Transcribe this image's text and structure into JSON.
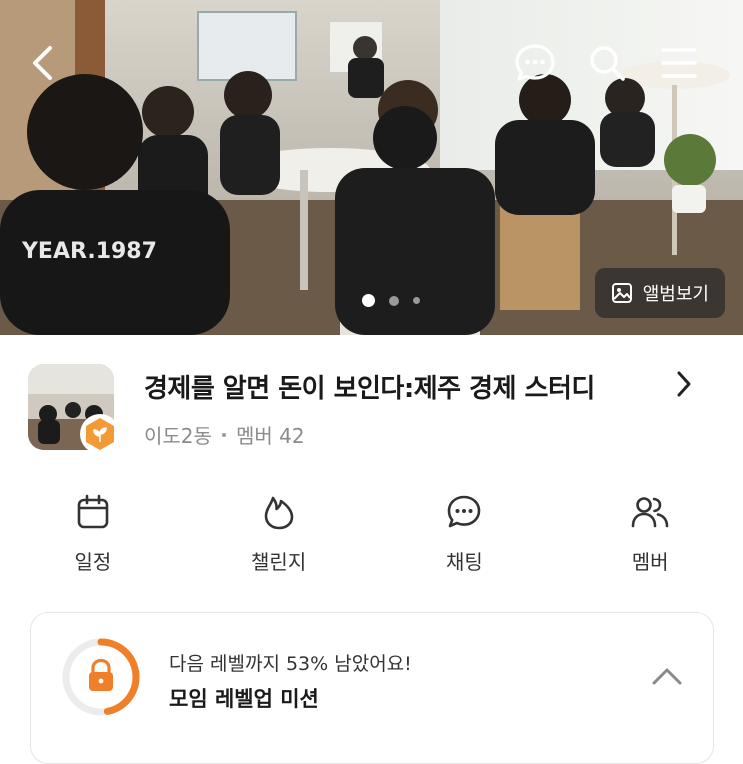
{
  "header": {
    "back_icon": "chevron-left-icon",
    "chat_icon": "chat-bubble-icon",
    "search_icon": "search-icon",
    "menu_icon": "hamburger-menu-icon"
  },
  "hero": {
    "photo_text": "YEAR.1987",
    "album_label": "앨범보기",
    "slide_count": 3,
    "active_slide": 1
  },
  "group": {
    "title": "경제를 알면 돈이 보인다:제주 경제 스터디",
    "location": "이도2동",
    "members": "멤버 42"
  },
  "actions": [
    {
      "label": "일정",
      "icon": "calendar-icon"
    },
    {
      "label": "챌린지",
      "icon": "flame-icon"
    },
    {
      "label": "채팅",
      "icon": "chat-bubble-icon"
    },
    {
      "label": "멤버",
      "icon": "people-icon"
    }
  ],
  "mission": {
    "subtitle": "다음 레벨까지 53% 남았어요!",
    "title": "모임 레벨업 미션",
    "progress": 0.47
  },
  "colors": {
    "accent_orange": "#f07f2a",
    "muted_text": "#8b8b8b"
  }
}
